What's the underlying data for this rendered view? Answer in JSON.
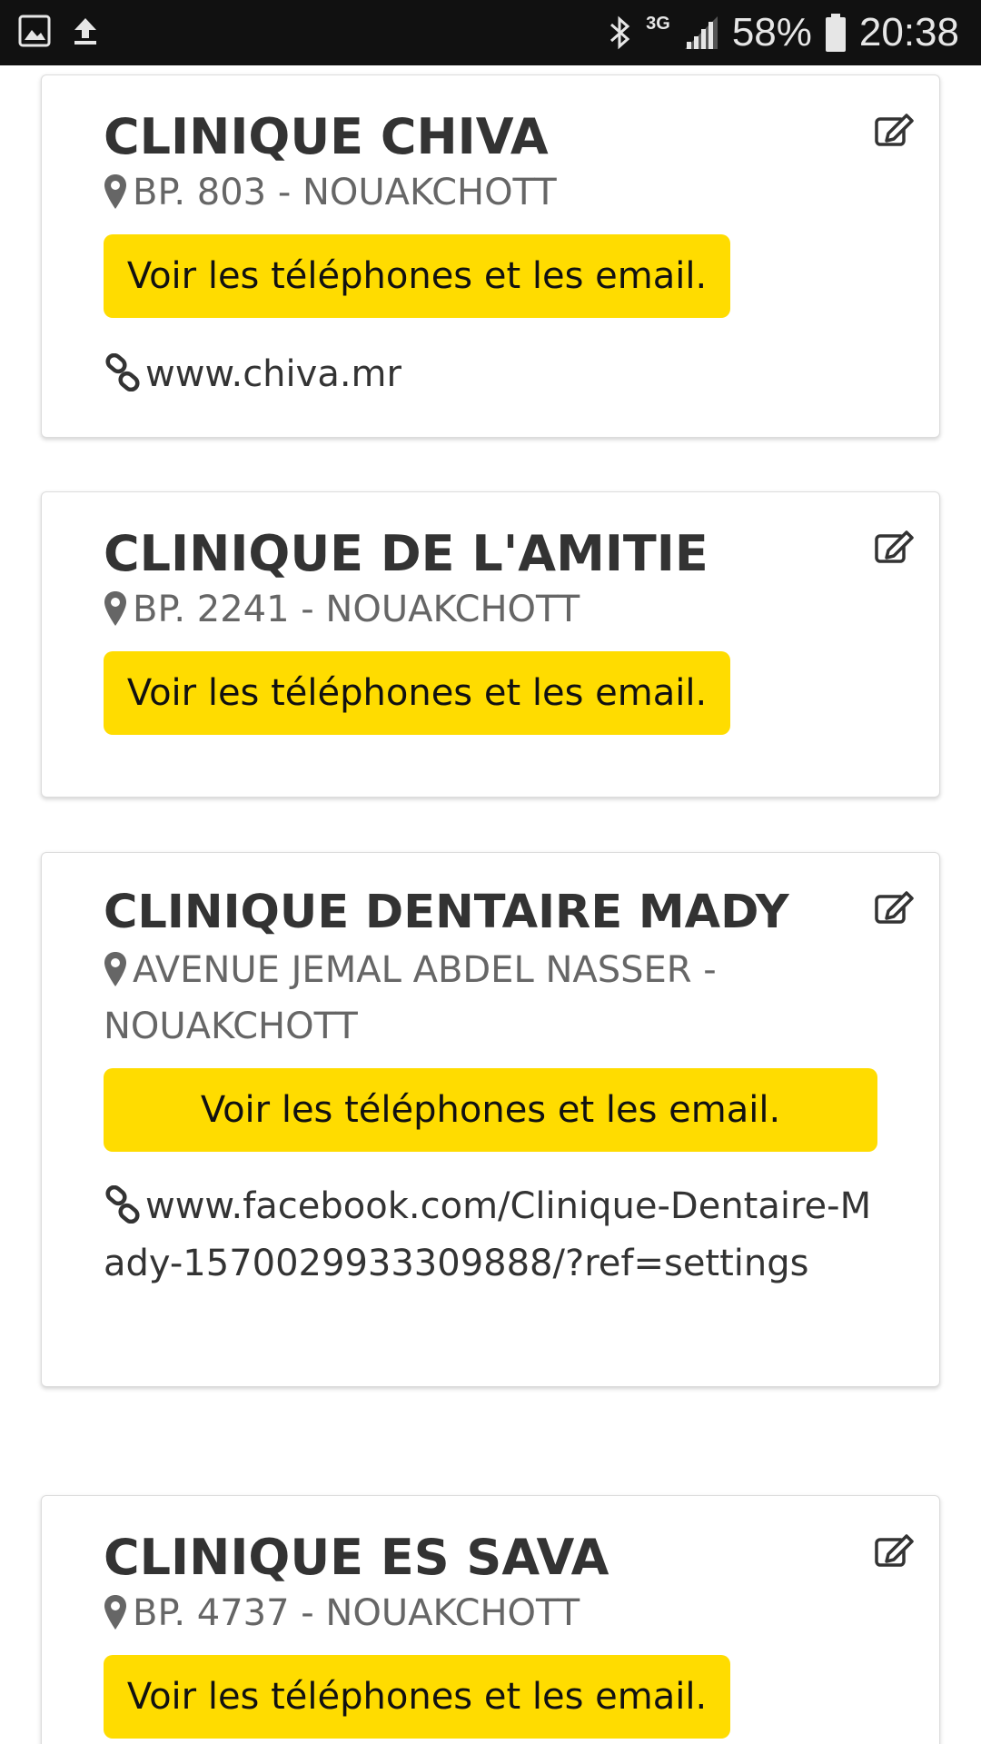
{
  "status_bar": {
    "battery": "58%",
    "time": "20:38",
    "network": "3G"
  },
  "clinics": [
    {
      "name": "CLINIQUE CHIVA",
      "address": "BP. 803 - NOUAKCHOTT",
      "button": "Voir les téléphones et les email.",
      "website": "www.chiva.mr"
    },
    {
      "name": "CLINIQUE DE L'AMITIE",
      "address": "BP. 2241 - NOUAKCHOTT",
      "button": "Voir les téléphones et les email."
    },
    {
      "name": "CLINIQUE DENTAIRE MADY",
      "address": "AVENUE JEMAL ABDEL NASSER - NOUAKCHOTT",
      "button": "Voir les téléphones et les email.",
      "website": "www.facebook.com/Clinique-Dentaire-Mady-1570029933309888/?ref=settings"
    },
    {
      "name": "CLINIQUE ES SAVA",
      "address": "BP. 4737 - NOUAKCHOTT",
      "button": "Voir les téléphones et les email."
    }
  ],
  "colors": {
    "accent": "#ffdc00",
    "title": "#333333",
    "address": "#666666",
    "statusbar": "#111111"
  },
  "icons": [
    "gallery-icon",
    "upload-icon",
    "bluetooth-icon",
    "signal-icon",
    "battery-icon",
    "edit-icon",
    "map-pin-icon",
    "link-icon"
  ]
}
